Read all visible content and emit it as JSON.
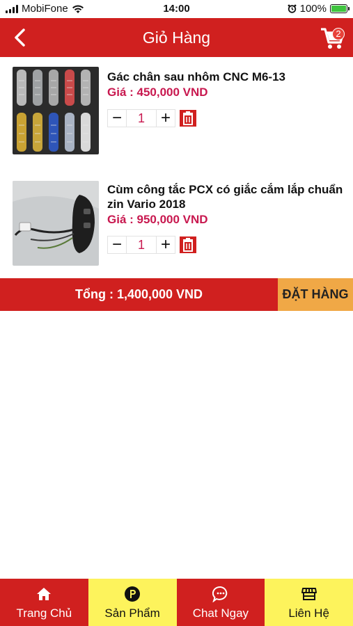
{
  "status_bar": {
    "carrier": "MobiFone",
    "time": "14:00",
    "battery": "100%"
  },
  "header": {
    "title": "Giỏ Hàng",
    "cart_count": "2"
  },
  "cart": {
    "items": [
      {
        "name": "Gác chân sau nhôm CNC M6-13",
        "price": "Giá : 450,000 VND",
        "quantity": "1",
        "thumbnail": "footrest-product-image"
      },
      {
        "name": "Cùm công tắc PCX có giắc cắm lắp chuẩn zin Vario 2018",
        "price": "Giá : 950,000 VND",
        "quantity": "1",
        "thumbnail": "switch-product-image"
      }
    ],
    "minus_symbol": "−",
    "plus_symbol": "+"
  },
  "total": {
    "label": "Tổng : 1,400,000 VND",
    "order_button": "ĐẶT HÀNG"
  },
  "bottom_nav": [
    {
      "label": "Trang Chủ",
      "icon": "home-icon"
    },
    {
      "label": "Sản Phẩm",
      "icon": "parking-icon"
    },
    {
      "label": "Chat Ngay",
      "icon": "chat-icon"
    },
    {
      "label": "Liên Hệ",
      "icon": "store-icon"
    }
  ],
  "colors": {
    "primary_red": "#d0201f",
    "price_color": "#c8184f",
    "order_button": "#f0a846",
    "nav_yellow": "#fdf35c"
  }
}
